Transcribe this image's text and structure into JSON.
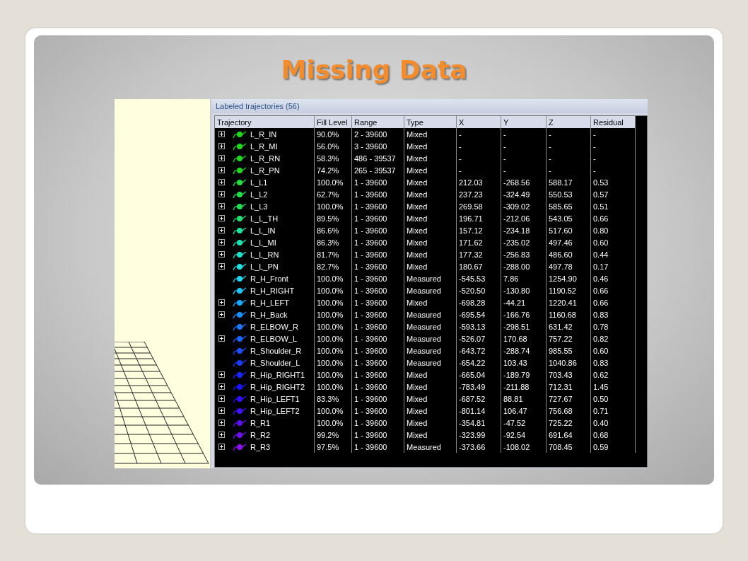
{
  "slide": {
    "title": "Missing Data"
  },
  "panel": {
    "title": "Labeled trajectories (56)"
  },
  "table": {
    "columns": [
      "Trajectory",
      "Fill Level",
      "Range",
      "Type",
      "X",
      "Y",
      "Z",
      "Residual"
    ],
    "rows": [
      {
        "expandable": true,
        "color": "#1fd81f",
        "cells": [
          "L_R_IN",
          "90.0%",
          "2 - 39600",
          "Mixed",
          "-",
          "-",
          "-",
          "-"
        ]
      },
      {
        "expandable": true,
        "color": "#1fd81f",
        "cells": [
          "L_R_MI",
          "56.0%",
          "3 - 39600",
          "Mixed",
          "-",
          "-",
          "-",
          "-"
        ]
      },
      {
        "expandable": true,
        "color": "#1fd81f",
        "cells": [
          "L_R_RN",
          "58.3%",
          "486 - 39537",
          "Mixed",
          "-",
          "-",
          "-",
          "-"
        ]
      },
      {
        "expandable": true,
        "color": "#1fd81f",
        "cells": [
          "L_R_PN",
          "74.2%",
          "265 - 39537",
          "Mixed",
          "-",
          "-",
          "-",
          "-"
        ]
      },
      {
        "expandable": true,
        "color": "#22e040",
        "cells": [
          "L_L1",
          "100.0%",
          "1 - 39600",
          "Mixed",
          "212.03",
          "-268.56",
          "588.17",
          "0.53"
        ]
      },
      {
        "expandable": true,
        "color": "#22e04a",
        "cells": [
          "L_L2",
          "62.7%",
          "1 - 39600",
          "Mixed",
          "237.23",
          "-324.49",
          "550.53",
          "0.57"
        ]
      },
      {
        "expandable": true,
        "color": "#22e055",
        "cells": [
          "L_L3",
          "100.0%",
          "1 - 39600",
          "Mixed",
          "269.58",
          "-309.02",
          "585.65",
          "0.51"
        ]
      },
      {
        "expandable": true,
        "color": "#22e070",
        "cells": [
          "L_L_TH",
          "89.5%",
          "1 - 39600",
          "Mixed",
          "196.71",
          "-212.06",
          "543.05",
          "0.66"
        ]
      },
      {
        "expandable": true,
        "color": "#1de39a",
        "cells": [
          "L_L_IN",
          "86.6%",
          "1 - 39600",
          "Mixed",
          "157.12",
          "-234.18",
          "517.60",
          "0.80"
        ]
      },
      {
        "expandable": true,
        "color": "#1de3b0",
        "cells": [
          "L_L_MI",
          "86.3%",
          "1 - 39600",
          "Mixed",
          "171.62",
          "-235.02",
          "497.46",
          "0.60"
        ]
      },
      {
        "expandable": true,
        "color": "#1ee3c8",
        "cells": [
          "L_L_RN",
          "81.7%",
          "1 - 39600",
          "Mixed",
          "177.32",
          "-256.83",
          "486.60",
          "0.44"
        ]
      },
      {
        "expandable": true,
        "color": "#1ee0e0",
        "cells": [
          "L_L_PN",
          "82.7%",
          "1 - 39600",
          "Mixed",
          "180.67",
          "-288.00",
          "497.78",
          "0.17"
        ]
      },
      {
        "expandable": false,
        "color": "#22d4ee",
        "cells": [
          "R_H_Front",
          "100.0%",
          "1 - 39600",
          "Measured",
          "-545.53",
          "7.86",
          "1254.90",
          "0.46"
        ]
      },
      {
        "expandable": false,
        "color": "#1ec4f5",
        "cells": [
          "R_H_RIGHT",
          "100.0%",
          "1 - 39600",
          "Measured",
          "-520.50",
          "-130.80",
          "1190.52",
          "0.66"
        ]
      },
      {
        "expandable": true,
        "color": "#1aa8ff",
        "cells": [
          "R_H_LEFT",
          "100.0%",
          "1 - 39600",
          "Mixed",
          "-698.28",
          "-44.21",
          "1220.41",
          "0.66"
        ]
      },
      {
        "expandable": true,
        "color": "#1a90ff",
        "cells": [
          "R_H_Back",
          "100.0%",
          "1 - 39600",
          "Measured",
          "-695.54",
          "-166.76",
          "1160.68",
          "0.83"
        ]
      },
      {
        "expandable": false,
        "color": "#1a78ff",
        "cells": [
          "R_ELBOW_R",
          "100.0%",
          "1 - 39600",
          "Measured",
          "-593.13",
          "-298.51",
          "631.42",
          "0.78"
        ]
      },
      {
        "expandable": true,
        "color": "#1a64ff",
        "cells": [
          "R_ELBOW_L",
          "100.0%",
          "1 - 39600",
          "Measured",
          "-526.07",
          "170.68",
          "757.22",
          "0.82"
        ]
      },
      {
        "expandable": false,
        "color": "#1a50ff",
        "cells": [
          "R_Shoulder_R",
          "100.0%",
          "1 - 39600",
          "Measured",
          "-643.72",
          "-288.74",
          "985.55",
          "0.60"
        ]
      },
      {
        "expandable": false,
        "color": "#1a3cff",
        "cells": [
          "R_Shoulder_L",
          "100.0%",
          "1 - 39600",
          "Measured",
          "-654.22",
          "103.43",
          "1040.86",
          "0.83"
        ]
      },
      {
        "expandable": true,
        "color": "#1a28ff",
        "cells": [
          "R_Hip_RIGHT1",
          "100.0%",
          "1 - 39600",
          "Mixed",
          "-665.04",
          "-189.79",
          "703.43",
          "0.62"
        ]
      },
      {
        "expandable": true,
        "color": "#1a14ff",
        "cells": [
          "R_Hip_RIGHT2",
          "100.0%",
          "1 - 39600",
          "Mixed",
          "-783.49",
          "-211.88",
          "712.31",
          "1.45"
        ]
      },
      {
        "expandable": true,
        "color": "#3010ff",
        "cells": [
          "R_Hip_LEFT1",
          "83.3%",
          "1 - 39600",
          "Mixed",
          "-687.52",
          "88.81",
          "727.67",
          "0.50"
        ]
      },
      {
        "expandable": true,
        "color": "#4010ff",
        "cells": [
          "R_Hip_LEFT2",
          "100.0%",
          "1 - 39600",
          "Mixed",
          "-801.14",
          "106.47",
          "756.68",
          "0.71"
        ]
      },
      {
        "expandable": true,
        "color": "#5a10f0",
        "cells": [
          "R_R1",
          "100.0%",
          "1 - 39600",
          "Mixed",
          "-354.81",
          "-47.52",
          "725.22",
          "0.40"
        ]
      },
      {
        "expandable": true,
        "color": "#7010ee",
        "cells": [
          "R_R2",
          "99.2%",
          "1 - 39600",
          "Mixed",
          "-323.99",
          "-92.54",
          "691.64",
          "0.68"
        ]
      },
      {
        "expandable": true,
        "color": "#8a10ee",
        "cells": [
          "R_R3",
          "97.5%",
          "1 - 39600",
          "Measured",
          "-373.66",
          "-108.02",
          "708.45",
          "0.59"
        ]
      }
    ]
  }
}
